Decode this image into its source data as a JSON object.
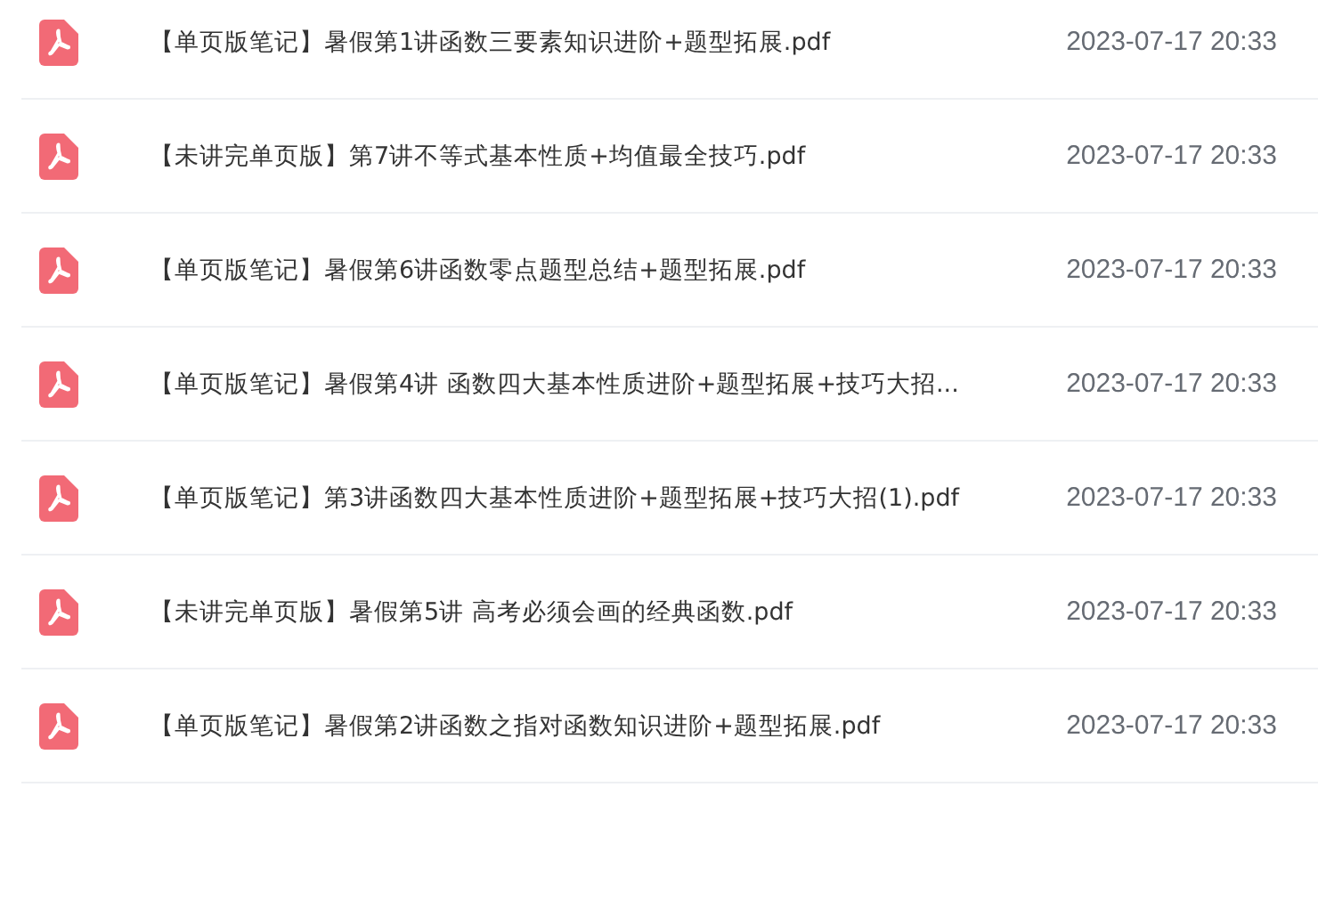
{
  "files": [
    {
      "name": "【单页版笔记】暑假第1讲函数三要素知识进阶+题型拓展.pdf",
      "date": "2023-07-17 20:33"
    },
    {
      "name": "【未讲完单页版】第7讲不等式基本性质+均值最全技巧.pdf",
      "date": "2023-07-17 20:33"
    },
    {
      "name": "【单页版笔记】暑假第6讲函数零点题型总结+题型拓展.pdf",
      "date": "2023-07-17 20:33"
    },
    {
      "name": "【单页版笔记】暑假第4讲 函数四大基本性质进阶+题型拓展+技巧大招...",
      "date": "2023-07-17 20:33"
    },
    {
      "name": "【单页版笔记】第3讲函数四大基本性质进阶+题型拓展+技巧大招(1).pdf",
      "date": "2023-07-17 20:33"
    },
    {
      "name": "【未讲完单页版】暑假第5讲 高考必须会画的经典函数.pdf",
      "date": "2023-07-17 20:33"
    },
    {
      "name": "【单页版笔记】暑假第2讲函数之指对函数知识进阶+题型拓展.pdf",
      "date": "2023-07-17 20:33"
    }
  ]
}
